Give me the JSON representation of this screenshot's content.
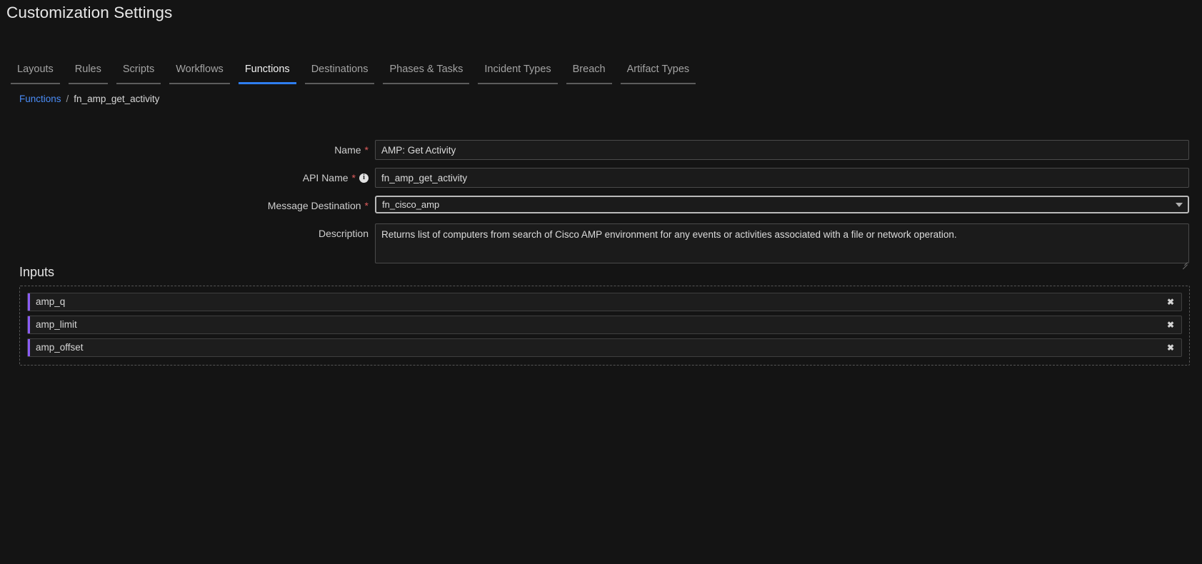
{
  "page": {
    "title": "Customization Settings"
  },
  "tabs": [
    {
      "label": "Layouts",
      "active": false
    },
    {
      "label": "Rules",
      "active": false
    },
    {
      "label": "Scripts",
      "active": false
    },
    {
      "label": "Workflows",
      "active": false
    },
    {
      "label": "Functions",
      "active": true
    },
    {
      "label": "Destinations",
      "active": false
    },
    {
      "label": "Phases & Tasks",
      "active": false
    },
    {
      "label": "Incident Types",
      "active": false
    },
    {
      "label": "Breach",
      "active": false
    },
    {
      "label": "Artifact Types",
      "active": false
    }
  ],
  "breadcrumb": {
    "parent": "Functions",
    "separator": "/",
    "current": "fn_amp_get_activity"
  },
  "form": {
    "name": {
      "label": "Name",
      "required": "*",
      "value": "AMP: Get Activity",
      "placeholder": ""
    },
    "api_name": {
      "label": "API Name",
      "required": "*",
      "info_glyph": "i",
      "value": "fn_amp_get_activity",
      "placeholder": ""
    },
    "message_destination": {
      "label": "Message Destination",
      "required": "*",
      "value": "fn_cisco_amp",
      "options": [
        "fn_cisco_amp"
      ]
    },
    "description": {
      "label": "Description",
      "value": "Returns list of computers from search of Cisco AMP environment for any events or activities associated with a file or network operation.",
      "placeholder": ""
    }
  },
  "inputs": {
    "title": "Inputs",
    "remove_glyph": "✖",
    "items": [
      {
        "label": "amp_q"
      },
      {
        "label": "amp_limit"
      },
      {
        "label": "amp_offset"
      }
    ]
  },
  "colors": {
    "background": "#141414",
    "accent_tab": "#2f7ef0",
    "accent_link": "#4a8cf7",
    "accent_input_bar": "#8b5cf6",
    "required_star": "#e05c5c",
    "text_primary": "#e8e8e8",
    "text_secondary": "#a3a3a3"
  }
}
